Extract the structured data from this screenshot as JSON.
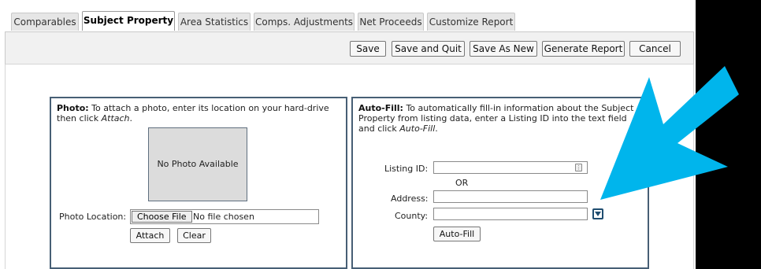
{
  "tabs": [
    {
      "label": "Comparables"
    },
    {
      "label": "Subject Property"
    },
    {
      "label": "Area Statistics"
    },
    {
      "label": "Comps. Adjustments"
    },
    {
      "label": "Net Proceeds"
    },
    {
      "label": "Customize Report"
    }
  ],
  "toolbar": {
    "save": "Save",
    "save_quit": "Save and Quit",
    "save_new": "Save As New",
    "generate": "Generate Report",
    "cancel": "Cancel"
  },
  "photo": {
    "title": "Photo:",
    "desc_a": " To attach a photo, enter its location on your hard-drive then click ",
    "desc_em": "Attach",
    "desc_b": ".",
    "placeholder_image": "No Photo Available",
    "location_label": "Photo Location:",
    "choose_file": "Choose File",
    "no_file": "No file chosen",
    "attach": "Attach",
    "clear": "Clear"
  },
  "autofill": {
    "title": "Auto-Fill:",
    "desc_a": " To automatically fill-in information about the Subject Property from listing data, enter a Listing ID into the text field and click ",
    "desc_em": "Auto-Fill",
    "desc_b": ".",
    "listing_label": "Listing ID:",
    "or": "OR",
    "address_label": "Address:",
    "county_label": "County:",
    "button": "Auto-Fill"
  },
  "colors": {
    "panel_border": "#475f75",
    "annotation_arrow": "#00b5ec"
  }
}
